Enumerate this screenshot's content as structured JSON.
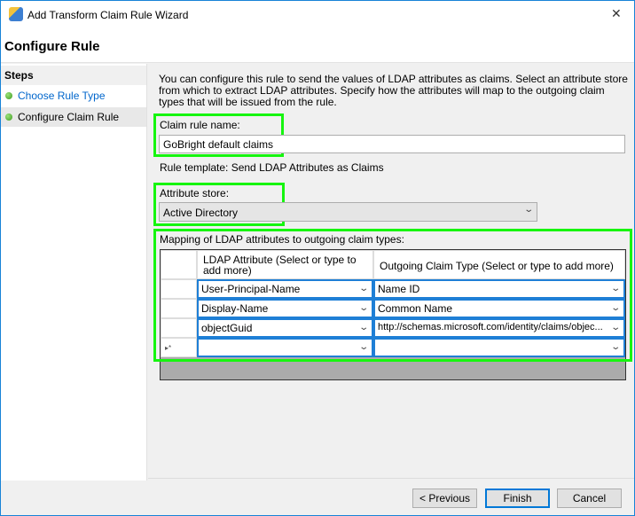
{
  "window": {
    "title": "Add Transform Claim Rule Wizard",
    "close_glyph": "✕"
  },
  "header": {
    "title": "Configure Rule"
  },
  "steps": {
    "heading": "Steps",
    "items": [
      {
        "label": "Choose Rule Type",
        "state": "link"
      },
      {
        "label": "Configure Claim Rule",
        "state": "current"
      }
    ]
  },
  "main": {
    "description": "You can configure this rule to send the values of LDAP attributes as claims. Select an attribute store from which to extract LDAP attributes. Specify how the attributes will map to the outgoing claim types that will be issued from the rule.",
    "claim_rule_name_label": "Claim rule name:",
    "claim_rule_name_value": "GoBright default claims",
    "rule_template": "Rule template: Send LDAP Attributes as Claims",
    "attribute_store_label": "Attribute store:",
    "attribute_store_value": "Active Directory",
    "mapping_label": "Mapping of LDAP attributes to outgoing claim types:",
    "columns": [
      "LDAP Attribute (Select or type to add more)",
      "Outgoing Claim Type (Select or type to add more)"
    ],
    "rows": [
      {
        "ldap": "User-Principal-Name",
        "claim": "Name ID"
      },
      {
        "ldap": "Display-Name",
        "claim": "Common Name"
      },
      {
        "ldap": "objectGuid",
        "claim": "http://schemas.microsoft.com/identity/claims/objec..."
      },
      {
        "ldap": "",
        "claim": ""
      }
    ],
    "new_row_marker": "▸*",
    "highlight_color": "#16f50f"
  },
  "buttons": {
    "previous": "< Previous",
    "finish": "Finish",
    "cancel": "Cancel"
  }
}
